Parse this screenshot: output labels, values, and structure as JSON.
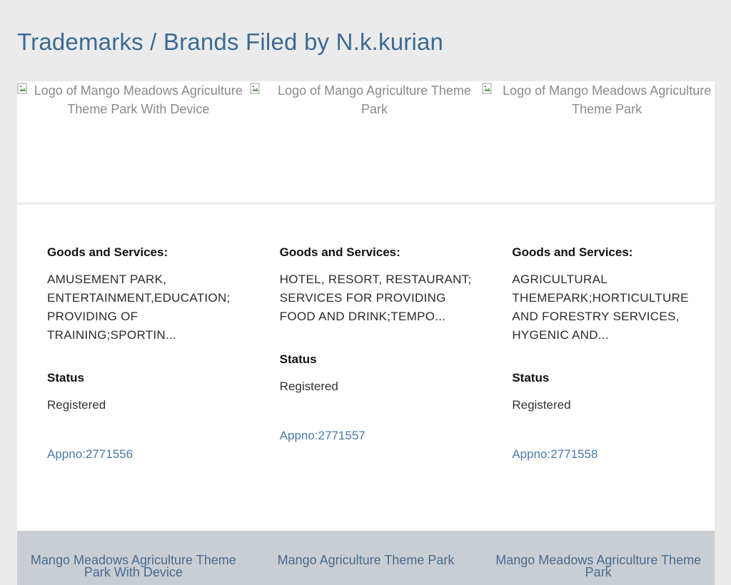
{
  "page": {
    "title": "Trademarks / Brands Filed by N.k.kurian"
  },
  "cards": [
    {
      "logo_alt": "Logo of Mango Meadows Agriculture Theme Park With Device",
      "goods_label": "Goods and Services:",
      "goods_text": "AMUSEMENT PARK, ENTERTAINMENT,EDUCATION; PROVIDING OF TRAINING;SPORTIN...",
      "status_label": "Status",
      "status_value": "Registered",
      "appno": "Appno:2771556",
      "footer_name": "Mango Meadows Agriculture Theme Park With Device"
    },
    {
      "logo_alt": "Logo of Mango Agriculture Theme Park",
      "goods_label": "Goods and Services:",
      "goods_text": "HOTEL, RESORT, RESTAURANT; SERVICES FOR PROVIDING FOOD AND DRINK;TEMPO...",
      "status_label": "Status",
      "status_value": "Registered",
      "appno": "Appno:2771557",
      "footer_name": "Mango Agriculture Theme Park"
    },
    {
      "logo_alt": "Logo of Mango Meadows Agriculture Theme Park",
      "goods_label": "Goods and Services:",
      "goods_text": "AGRICULTURAL THEMEPARK;HORTICULTURE AND FORESTRY SERVICES, HYGENIC AND...",
      "status_label": "Status",
      "status_value": "Registered",
      "appno": "Appno:2771558",
      "footer_name": "Mango Meadows Agriculture Theme Park"
    }
  ]
}
